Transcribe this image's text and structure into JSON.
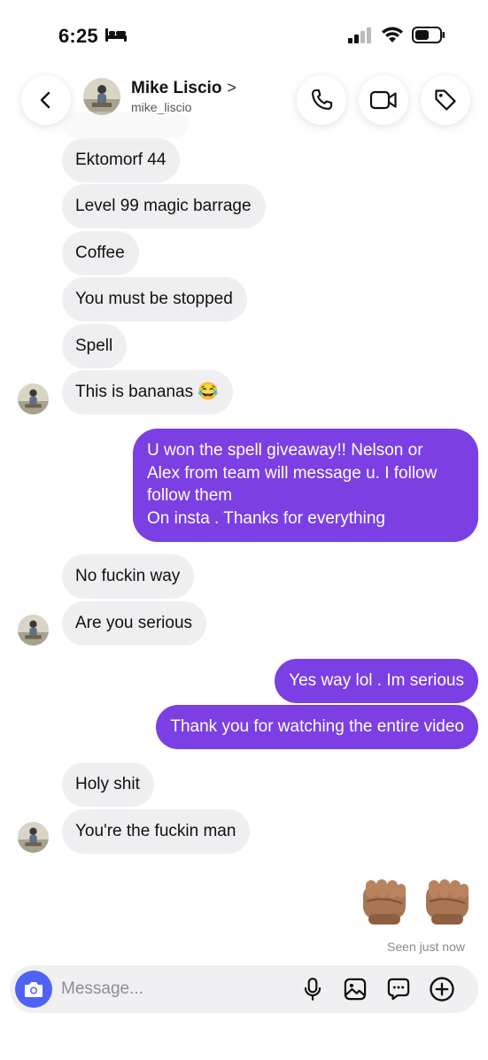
{
  "status_bar": {
    "time": "6:25"
  },
  "header": {
    "contact_name": "Mike Liscio",
    "contact_handle": "mike_liscio",
    "chevron": ">"
  },
  "messages": [
    {
      "text": "Ektomorf 44"
    },
    {
      "text": "Level 99 magic barrage"
    },
    {
      "text": "Coffee"
    },
    {
      "text": "You must be stopped"
    },
    {
      "text": "Spell"
    },
    {
      "text": "This is bananas 😂"
    },
    {
      "lines": [
        "U won the spell giveaway!!  Nelson or",
        "Alex from team will message u. I follow",
        "follow them",
        "On insta . Thanks for everything"
      ]
    },
    {
      "text": "No fuckin way"
    },
    {
      "text": "Are you serious"
    },
    {
      "text": "Yes way lol . Im serious"
    },
    {
      "text": "Thank you for watching the entire video"
    },
    {
      "text": "Holy shit"
    },
    {
      "text": "You're the fuckin man"
    }
  ],
  "reaction_emoji": [
    "👊🏽",
    "👊🏽"
  ],
  "seen_status": "Seen just now",
  "composer": {
    "placeholder": "Message..."
  },
  "colors": {
    "outgoing_bubble": "#7b3fe4",
    "incoming_bubble": "#efeff2",
    "camera_button": "#4e63f5"
  },
  "icons": [
    "bed-icon",
    "cellular-signal-icon",
    "wifi-icon",
    "battery-icon",
    "back-arrow-icon",
    "phone-icon",
    "video-camera-icon",
    "tag-icon",
    "camera-icon",
    "microphone-icon",
    "gallery-icon",
    "sticker-chat-icon",
    "add-icon"
  ]
}
